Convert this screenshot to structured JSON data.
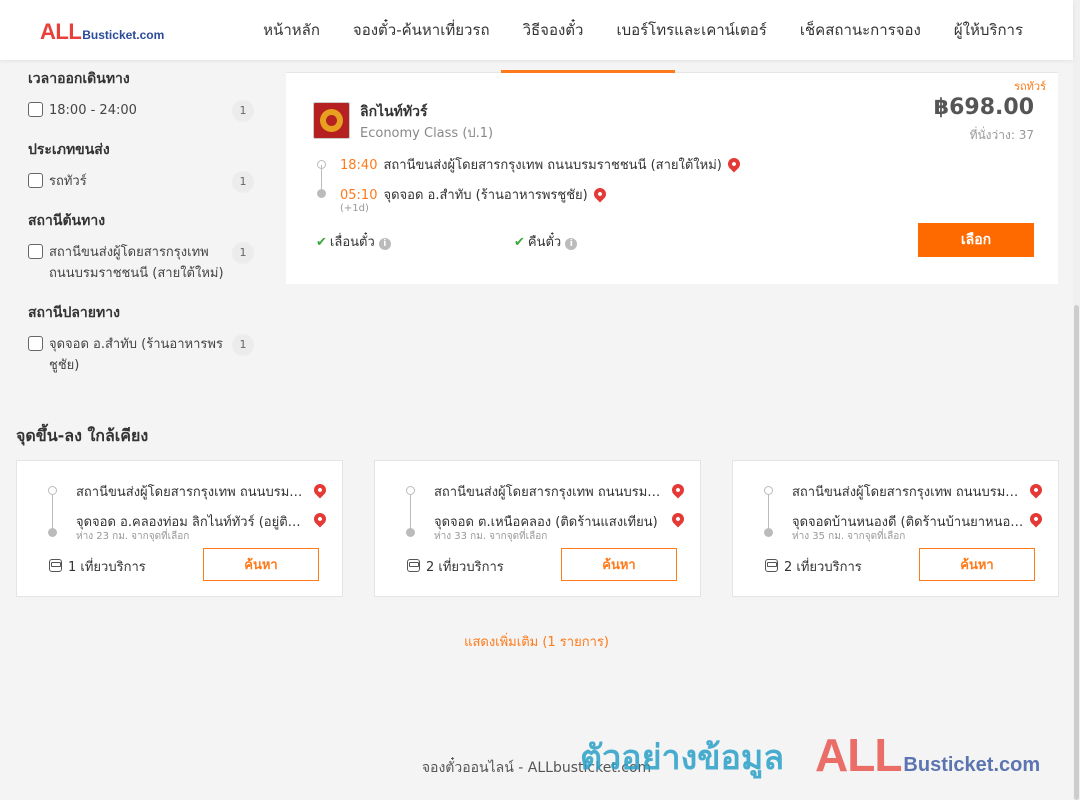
{
  "header": {
    "logo_all": "ALL",
    "logo_rest": "Busticket.com",
    "nav": [
      "หน้าหลัก",
      "จองตั๋ว-ค้นหาเที่ยวรถ",
      "วิธีจองตั๋ว",
      "เบอร์โทรและเคาน์เตอร์",
      "เช็คสถานะการจอง",
      "ผู้ให้บริการ"
    ]
  },
  "filters": {
    "departure_time": {
      "title": "เวลาออกเดินทาง",
      "items": [
        {
          "label": "18:00 - 24:00",
          "count": "1"
        }
      ]
    },
    "transport_type": {
      "title": "ประเภทขนส่ง",
      "items": [
        {
          "label": "รถทัวร์",
          "count": "1"
        }
      ]
    },
    "origin": {
      "title": "สถานีต้นทาง",
      "items": [
        {
          "label": "สถานีขนส่งผู้โดยสารกรุงเทพ ถนนบรมราชชนนี (สายใต้ใหม่)",
          "count": "1"
        }
      ]
    },
    "destination": {
      "title": "สถานีปลายทาง",
      "items": [
        {
          "label": "จุดจอด อ.สำทับ (ร้านอาหารพรชูชัย)",
          "count": "1"
        }
      ]
    }
  },
  "result": {
    "tag": "รถทัวร์",
    "operator": "ลิกไนท์ทัวร์",
    "class": "Economy Class (ป.1)",
    "price": "฿698.00",
    "seats": "ที่นั่งว่าง: 37",
    "depart_time": "18:40",
    "depart_place": "สถานีขนส่งผู้โดยสารกรุงเทพ ถนนบรมราชชนนี (สายใต้ใหม่)",
    "arrive_time": "05:10",
    "arrive_place": "จุดจอด อ.สำทับ (ร้านอาหารพรชูชัย)",
    "next_day": "(+1d)",
    "feature1": "เลื่อนตั๋ว",
    "feature2": "คืนตั๋ว",
    "select_label": "เลือก"
  },
  "nearby": {
    "title": "จุดขึ้น-ลง ใกล้เคียง",
    "search_label": "ค้นหา",
    "cards": [
      {
        "from": "สถานีขนส่งผู้โดยสารกรุงเทพ ถนนบรมราชชนนี (สายใต้ใหม่)",
        "to": "จุดจอด อ.คลองท่อม ลิกไนท์ทัวร์ (อยู่ติดถนน)",
        "distance": "ห่าง 23 กม. จากจุดที่เลือก",
        "trips": "1 เที่ยวบริการ"
      },
      {
        "from": "สถานีขนส่งผู้โดยสารกรุงเทพ ถนนบรมราชชนนี (สายใต้ใหม่)",
        "to": "จุดจอด ต.เหนือคลอง (ติดร้านแสงเทียน)",
        "distance": "ห่าง 33 กม. จากจุดที่เลือก",
        "trips": "2 เที่ยวบริการ"
      },
      {
        "from": "สถานีขนส่งผู้โดยสารกรุงเทพ ถนนบรมราชชนนี (สายใต้ใหม่)",
        "to": "จุดจอดบ้านหนองดี (ติดร้านบ้านยาหนองดี)",
        "distance": "ห่าง 35 กม. จากจุดที่เลือก",
        "trips": "2 เที่ยวบริการ"
      }
    ],
    "show_more": "แสดงเพิ่มเติม (1 รายการ)"
  },
  "footer": {
    "text": "จองตั๋วออนไลน์ - ALLbusticket.com"
  },
  "watermark": {
    "text": "ตัวอย่างข้อมูล",
    "logo_all": "ALL",
    "logo_rest": "Busticket.com"
  },
  "colors": {
    "accent": "#ff6a00",
    "pin": "#e53935",
    "check": "#3aa83a",
    "logo_red": "#e8403a",
    "logo_blue": "#2a4a9a"
  }
}
